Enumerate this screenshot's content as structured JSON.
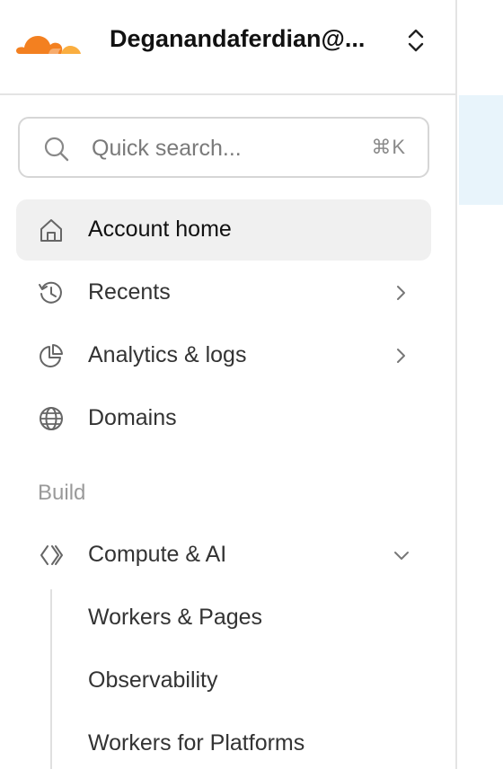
{
  "account": {
    "name": "Deganandaferdian@..."
  },
  "search": {
    "placeholder": "Quick search...",
    "shortcut": "⌘K"
  },
  "nav": {
    "items": [
      {
        "label": "Account home",
        "icon": "home-icon",
        "active": true
      },
      {
        "label": "Recents",
        "icon": "history-icon",
        "chevron": "right"
      },
      {
        "label": "Analytics & logs",
        "icon": "pie-chart-icon",
        "chevron": "right"
      },
      {
        "label": "Domains",
        "icon": "globe-icon"
      }
    ],
    "section_build": "Build",
    "build_items": [
      {
        "label": "Compute & AI",
        "icon": "compute-icon",
        "chevron": "down"
      }
    ],
    "compute_subitems": [
      "Workers & Pages",
      "Observability",
      "Workers for Platforms"
    ]
  },
  "colors": {
    "brand_orange": "#f38020",
    "brand_orange_light": "#faae40",
    "active_bg": "#f0f0f0",
    "main_strip": "#e8f4fb"
  }
}
